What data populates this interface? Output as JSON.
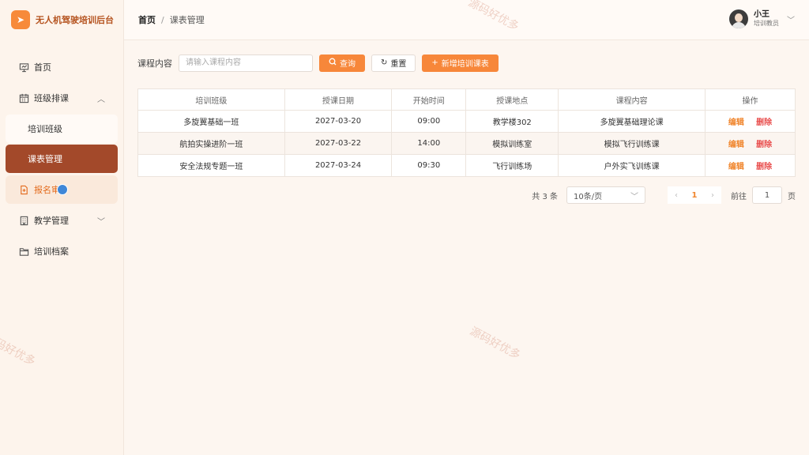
{
  "app": {
    "logo_glyph": "➤",
    "title": "无人机驾驶培训后台"
  },
  "sidebar": {
    "items": [
      {
        "label": "首页",
        "icon": "chart-board-icon"
      },
      {
        "label": "班级排课",
        "icon": "calendar-icon",
        "expanded": true
      },
      {
        "label": "培训班级"
      },
      {
        "label": "课表管理"
      },
      {
        "label": "报名审",
        "icon": "document-icon"
      },
      {
        "label": "教学管理",
        "icon": "building-icon"
      },
      {
        "label": "培训档案",
        "icon": "folder-icon"
      }
    ]
  },
  "header": {
    "breadcrumb_home": "首页",
    "breadcrumb_sep": "/",
    "breadcrumb_current": "课表管理",
    "user_name": "小王",
    "user_role": "培训教员"
  },
  "filter": {
    "label": "课程内容",
    "placeholder": "请输入课程内容",
    "value": "",
    "search_label": "查询",
    "reset_label": "重置",
    "add_label": "新增培训课表"
  },
  "table": {
    "headers": [
      "培训班级",
      "授课日期",
      "开始时间",
      "授课地点",
      "课程内容",
      "操作"
    ],
    "rows": [
      [
        "多旋翼基础一班",
        "2027-03-20",
        "09:00",
        "教学楼302",
        "多旋翼基础理论课"
      ],
      [
        "航拍实操进阶一班",
        "2027-03-22",
        "14:00",
        "模拟训练室",
        "模拟飞行训练课"
      ],
      [
        "安全法规专题一班",
        "2027-03-24",
        "09:30",
        "飞行训练场",
        "户外实飞训练课"
      ]
    ],
    "edit_label": "编辑",
    "delete_label": "删除"
  },
  "pagination": {
    "total": "共 3 条",
    "page_size": "10条/页",
    "current_page": "1",
    "goto_prefix": "前往",
    "goto_value": "1",
    "goto_suffix": "页"
  },
  "watermark": "源码好优多",
  "colors": {
    "accent": "#f7873a",
    "active_nav": "#a3492a",
    "danger": "#e9504f"
  }
}
